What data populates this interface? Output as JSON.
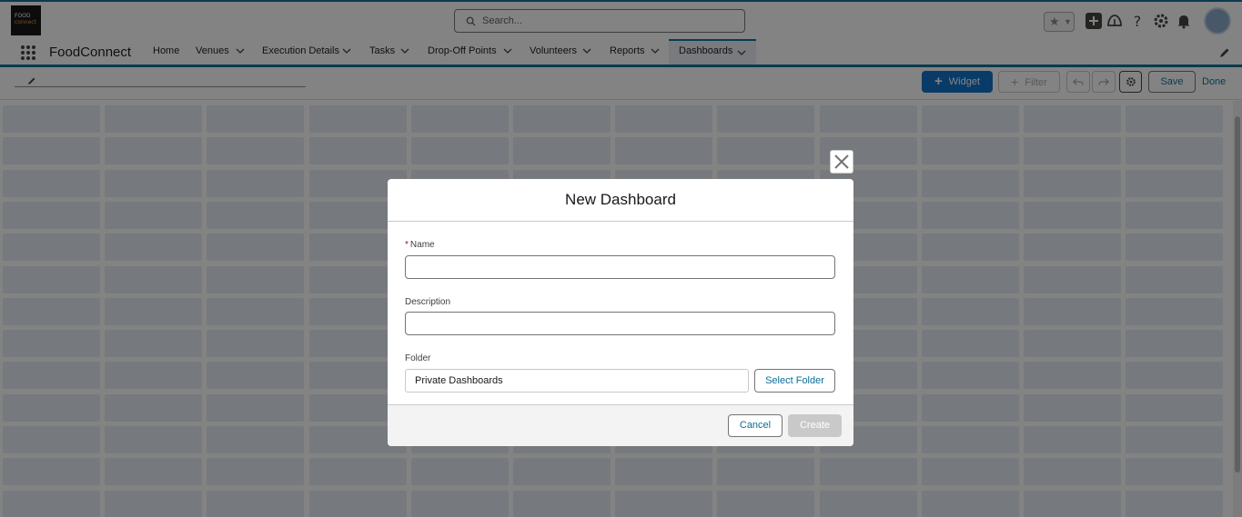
{
  "header": {
    "logo_text_top": "FOOD",
    "logo_text_bottom": "connect",
    "search_placeholder": "Search..."
  },
  "nav": {
    "app_name": "FoodConnect",
    "tabs": [
      {
        "label": "Home",
        "has_menu": false
      },
      {
        "label": "Venues",
        "has_menu": true
      },
      {
        "label": "Execution Details",
        "has_menu": true
      },
      {
        "label": "Tasks",
        "has_menu": true
      },
      {
        "label": "Drop-Off Points",
        "has_menu": true
      },
      {
        "label": "Volunteers",
        "has_menu": true
      },
      {
        "label": "Reports",
        "has_menu": true
      },
      {
        "label": "Dashboards",
        "has_menu": true,
        "active": true
      }
    ]
  },
  "toolbar": {
    "widget_label": "Widget",
    "filter_label": "Filter",
    "save_label": "Save",
    "done_label": "Done"
  },
  "modal": {
    "title": "New Dashboard",
    "name_label": "Name",
    "name_value": "",
    "description_label": "Description",
    "description_value": "",
    "folder_label": "Folder",
    "folder_value": "Private Dashboards",
    "select_folder_label": "Select Folder",
    "cancel_label": "Cancel",
    "create_label": "Create"
  },
  "colors": {
    "brand": "#0b6ec9",
    "link": "#0b6e99",
    "required": "#ba0517",
    "grid_cell": "#e4ebf3"
  }
}
